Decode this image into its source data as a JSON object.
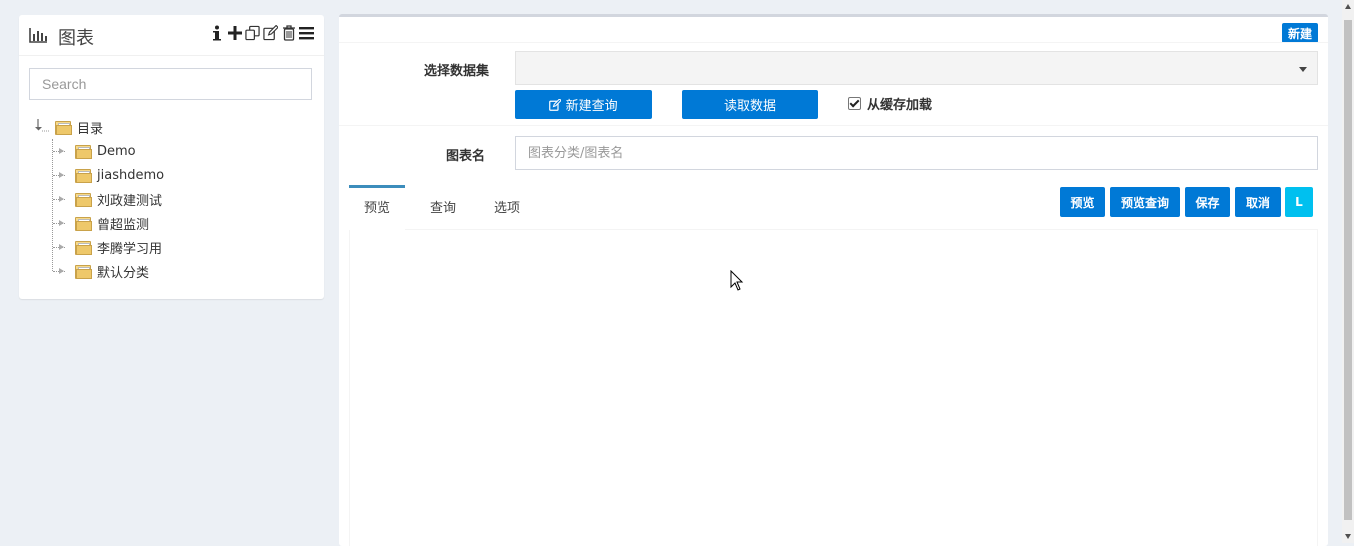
{
  "sidebar": {
    "title": "图表",
    "title_icon": "bar-chart-icon",
    "tools": [
      "info-icon",
      "plus-icon",
      "copy-icon",
      "edit-icon",
      "trash-icon",
      "menu-icon"
    ],
    "search_placeholder": "Search",
    "tree": {
      "root": "目录",
      "children": [
        "Demo",
        "jiashdemo",
        "刘政建测试",
        "曾超监测",
        "李腾学习用",
        "默认分类"
      ]
    }
  },
  "main": {
    "new_label": "新建",
    "dataset_label": "选择数据集",
    "new_query_label": "新建查询",
    "read_data_label": "读取数据",
    "cache_label": "从缓存加载",
    "cache_checked": true,
    "chart_name_label": "图表名",
    "chart_name_placeholder": "图表分类/图表名",
    "tabs": [
      "预览",
      "查询",
      "选项"
    ],
    "active_tab": "预览",
    "actions": {
      "preview": "预览",
      "preview_query": "预览查询",
      "save": "保存",
      "cancel": "取消",
      "l": "L"
    }
  },
  "colors": {
    "primary": "#0079d6",
    "cyan": "#00c0ef",
    "background": "#ecf0f5",
    "tab_active": "#3c8dbc"
  }
}
